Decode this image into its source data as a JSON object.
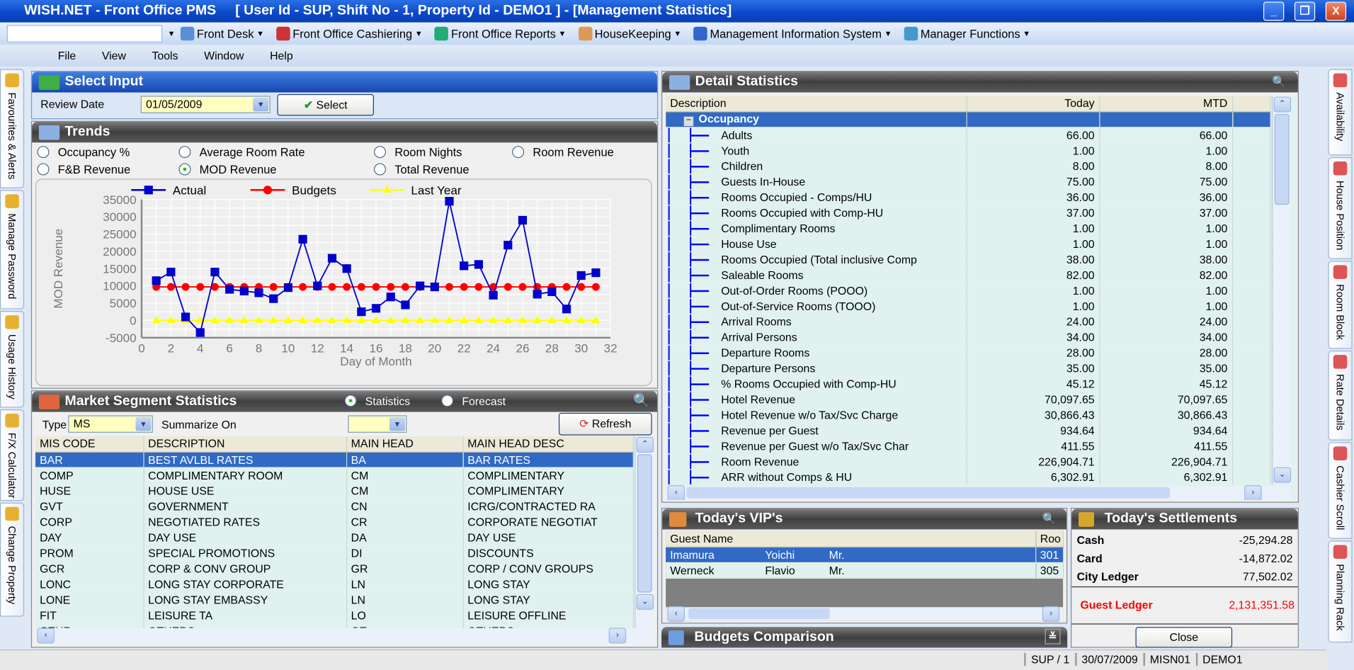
{
  "window": {
    "title": "WISH.NET - Front Office PMS     [ User Id - SUP, Shift No - 1, Property Id - DEMO1 ] - [Management Statistics]",
    "min": "_",
    "restore": "❐",
    "close": "X"
  },
  "toolbar": {
    "items": [
      "Front Desk",
      "Front Office Cashiering",
      "Front Office Reports",
      "HouseKeeping",
      "Management Information System",
      "Manager Functions"
    ]
  },
  "menu": [
    "File",
    "View",
    "Tools",
    "Window",
    "Help"
  ],
  "left_tabs": [
    "Favourites & Alerts",
    "Manage Password",
    "Usage History",
    "F/X Calculator",
    "Change Property"
  ],
  "right_tabs": [
    "Availability",
    "House Position",
    "Room Block",
    "Rate Details",
    "Cashier Scroll",
    "Planning Rack"
  ],
  "select_input": {
    "title": "Select Input",
    "review_date_label": "Review Date",
    "review_date": "01/05/2009",
    "select_label": "Select"
  },
  "trends": {
    "title": "Trends",
    "options": [
      "Occupancy %",
      "Average Room Rate",
      "Room Nights",
      "Room Revenue",
      "F&B Revenue",
      "MOD Revenue",
      "Total Revenue"
    ],
    "selected": "MOD Revenue"
  },
  "chart_data": {
    "type": "line",
    "ylabel": "MOD Revenue",
    "xlabel": "Day of Month",
    "xlim": [
      0,
      32
    ],
    "ylim": [
      -5000,
      35000
    ],
    "xticks": [
      0,
      2,
      4,
      6,
      8,
      10,
      12,
      14,
      16,
      18,
      20,
      22,
      24,
      26,
      28,
      30,
      32
    ],
    "yticks": [
      35000,
      30000,
      25000,
      20000,
      15000,
      10000,
      5000,
      0,
      -5000
    ],
    "grid": true,
    "legend": "top",
    "x": [
      1,
      2,
      3,
      4,
      5,
      6,
      7,
      8,
      9,
      10,
      11,
      12,
      13,
      14,
      15,
      16,
      17,
      18,
      19,
      20,
      21,
      22,
      23,
      24,
      25,
      26,
      27,
      28,
      29,
      30,
      31
    ],
    "series": [
      {
        "name": "Actual",
        "color": "#0000cc",
        "marker": "square",
        "values": [
          11500,
          14000,
          1000,
          -3500,
          14000,
          9000,
          8500,
          8000,
          6300,
          9500,
          23500,
          10000,
          18000,
          15000,
          2500,
          3500,
          6800,
          4500,
          10000,
          9700,
          34500,
          15800,
          16200,
          7300,
          21800,
          29000,
          7600,
          8300,
          3300,
          13000,
          13800
        ]
      },
      {
        "name": "Budgets",
        "color": "#ff0000",
        "marker": "circle",
        "values": [
          9700,
          9700,
          9700,
          9700,
          9700,
          9700,
          9700,
          9700,
          9700,
          9700,
          9700,
          9700,
          9700,
          9700,
          9700,
          9700,
          9700,
          9700,
          9700,
          9700,
          9700,
          9700,
          9700,
          9700,
          9700,
          9700,
          9700,
          9700,
          9700,
          9700,
          9700
        ]
      },
      {
        "name": "Last Year",
        "color": "#ffff00",
        "marker": "triangle",
        "values": [
          0,
          0,
          0,
          0,
          0,
          0,
          0,
          0,
          0,
          0,
          0,
          0,
          0,
          0,
          0,
          0,
          0,
          0,
          0,
          0,
          0,
          0,
          0,
          0,
          0,
          0,
          0,
          0,
          0,
          0,
          0
        ]
      }
    ]
  },
  "market": {
    "title": "Market Segment Statistics",
    "mode_options": [
      "Statistics",
      "Forecast"
    ],
    "mode_selected": "Statistics",
    "type_label": "Type",
    "type_value": "MS",
    "summarize_label": "Summarize On",
    "summarize_value": "",
    "refresh_label": "Refresh",
    "columns": [
      "MIS CODE",
      "DESCRIPTION",
      "MAIN HEAD",
      "MAIN HEAD DESC"
    ],
    "rows": [
      [
        "BAR",
        "BEST AVLBL RATES",
        "BA",
        "BAR RATES"
      ],
      [
        "COMP",
        "COMPLIMENTARY ROOM",
        "CM",
        "COMPLIMENTARY"
      ],
      [
        "HUSE",
        "HOUSE USE",
        "CM",
        "COMPLIMENTARY"
      ],
      [
        "GVT",
        "GOVERNMENT",
        "CN",
        "ICRG/CONTRACTED RA"
      ],
      [
        "CORP",
        "NEGOTIATED RATES",
        "CR",
        "CORPORATE NEGOTIAT"
      ],
      [
        "DAY",
        "DAY USE",
        "DA",
        "DAY USE"
      ],
      [
        "PROM",
        "SPECIAL PROMOTIONS",
        "DI",
        "DISCOUNTS"
      ],
      [
        "GCR",
        "CORP & CONV GROUP",
        "GR",
        "CORP / CONV GROUPS"
      ],
      [
        "LONC",
        "LONG STAY CORPORATE",
        "LN",
        "LONG STAY"
      ],
      [
        "LONE",
        "LONG STAY EMBASSY",
        "LN",
        "LONG STAY"
      ],
      [
        "FIT",
        "LEISURE TA",
        "LO",
        "LEISURE OFFLINE"
      ],
      [
        "OTHR",
        "OTHERS",
        "OT",
        "OTHERS"
      ]
    ]
  },
  "detail": {
    "title": "Detail Statistics",
    "columns": [
      "Description",
      "Today",
      "MTD"
    ],
    "group": "Occupancy",
    "rows": [
      [
        "Adults",
        "66.00",
        "66.00"
      ],
      [
        "Youth",
        "1.00",
        "1.00"
      ],
      [
        "Children",
        "8.00",
        "8.00"
      ],
      [
        "Guests In-House",
        "75.00",
        "75.00"
      ],
      [
        "Rooms Occupied - Comps/HU",
        "36.00",
        "36.00"
      ],
      [
        "Rooms Occupied with Comp-HU",
        "37.00",
        "37.00"
      ],
      [
        "Complimentary Rooms",
        "1.00",
        "1.00"
      ],
      [
        "House Use",
        "1.00",
        "1.00"
      ],
      [
        "Rooms Occupied (Total inclusive Comp",
        "38.00",
        "38.00"
      ],
      [
        "Saleable Rooms",
        "82.00",
        "82.00"
      ],
      [
        "Out-of-Order Rooms (POOO)",
        "1.00",
        "1.00"
      ],
      [
        "Out-of-Service Rooms (TOOO)",
        "1.00",
        "1.00"
      ],
      [
        "Arrival Rooms",
        "24.00",
        "24.00"
      ],
      [
        "Arrival Persons",
        "34.00",
        "34.00"
      ],
      [
        "Departure Rooms",
        "28.00",
        "28.00"
      ],
      [
        "Departure Persons",
        "35.00",
        "35.00"
      ],
      [
        "% Rooms Occupied with Comp-HU",
        "45.12",
        "45.12"
      ],
      [
        "Hotel Revenue",
        "70,097.65",
        "70,097.65"
      ],
      [
        "Hotel Revenue w/o Tax/Svc Charge",
        "30,866.43",
        "30,866.43"
      ],
      [
        "Revenue per Guest",
        "934.64",
        "934.64"
      ],
      [
        "Revenue per Guest w/o Tax/Svc Char",
        "411.55",
        "411.55"
      ],
      [
        "Room Revenue",
        "226,904.71",
        "226,904.71"
      ],
      [
        "ARR without Comps & HU",
        "6,302.91",
        "6,302.91"
      ]
    ]
  },
  "vip": {
    "title": "Today's VIP's",
    "columns": [
      "Guest Name",
      "Roo"
    ],
    "rows": [
      [
        "Imamura",
        "Yoichi",
        "Mr.",
        "301"
      ],
      [
        "Werneck",
        "Flavio",
        "Mr.",
        "305"
      ]
    ]
  },
  "budgets": {
    "title": "Budgets Comparison"
  },
  "settlements": {
    "title": "Today's Settlements",
    "rows": [
      [
        "Cash",
        "-25,294.28"
      ],
      [
        "Card",
        "-14,872.02"
      ],
      [
        "City Ledger",
        "77,502.02"
      ]
    ],
    "guest_ledger_label": "Guest Ledger",
    "guest_ledger": "2,131,351.58",
    "close_label": "Close"
  },
  "status": [
    "SUP / 1",
    "30/07/2009",
    "MISN01",
    "DEMO1"
  ],
  "colors": {
    "title_bar": "#0a47c8",
    "selection": "#316ac5",
    "guest_ledger": "#ff0000"
  }
}
